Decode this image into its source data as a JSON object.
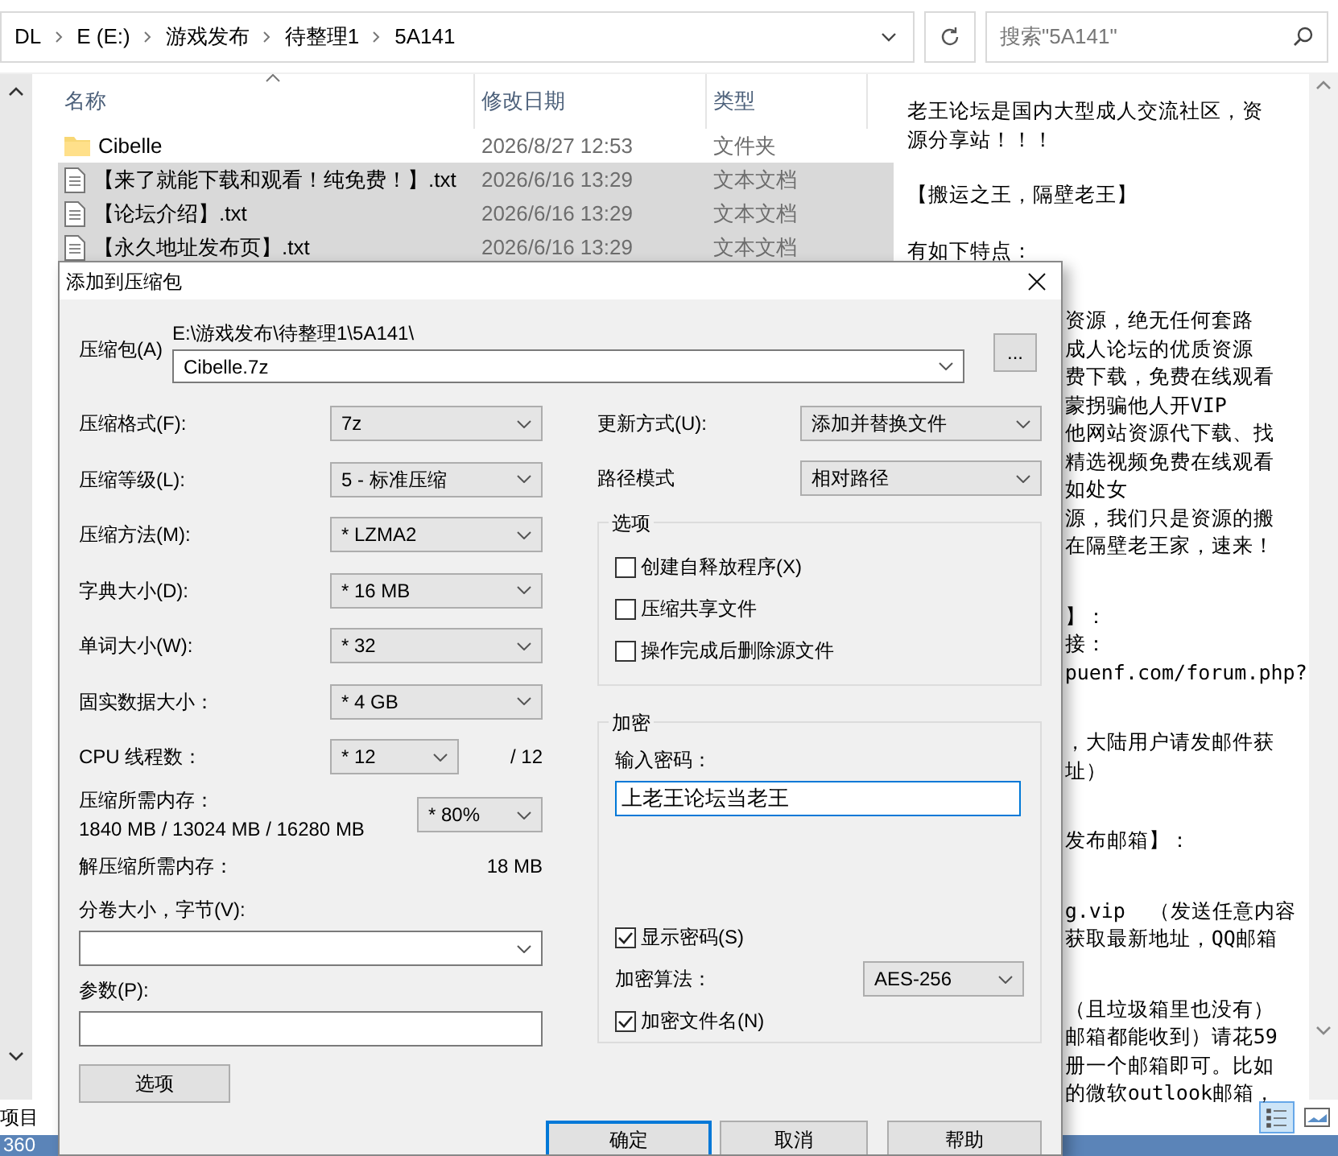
{
  "address_bar": {
    "crumbs": [
      "DL",
      "E (E:)",
      "游戏发布",
      "待整理1",
      "5A141"
    ],
    "search": {
      "placeholder": "搜索\"5A141\""
    }
  },
  "file_list": {
    "columns": [
      {
        "label": "名称",
        "sorted": true
      },
      {
        "label": "修改日期",
        "sorted": false
      },
      {
        "label": "类型",
        "sorted": false
      }
    ],
    "rows": [
      {
        "kind": "folder",
        "name": "Cibelle",
        "date": "2026/8/27 12:53",
        "type": "文件夹",
        "selected": false
      },
      {
        "kind": "text",
        "name": "【来了就能下载和观看！纯免费！】.txt",
        "date": "2026/6/16 13:29",
        "type": "文本文档",
        "selected": true
      },
      {
        "kind": "text",
        "name": "【论坛介绍】.txt",
        "date": "2026/6/16 13:29",
        "type": "文本文档",
        "selected": true
      },
      {
        "kind": "text",
        "name": "【永久地址发布页】.txt",
        "date": "2026/6/16 13:29",
        "type": "文本文档",
        "selected": true
      }
    ]
  },
  "preview": {
    "paragraphs": [
      {
        "kind": "full",
        "lines": [
          "老王论坛是国内大型成人交流社区，资",
          "源分享站！！！"
        ]
      },
      {
        "kind": "full",
        "lines": [
          "【搬运之王，隔壁老王】"
        ]
      },
      {
        "kind": "full",
        "lines": [
          "有如下特点："
        ]
      },
      {
        "kind": "partial",
        "lines": [
          "资源，绝无任何套路",
          "成人论坛的优质资源",
          "费下载，免费在线观看",
          "蒙拐骗他人开VIP",
          "他网站资源代下载、找",
          "精选视频免费在线观看",
          "如处女",
          "源，我们只是资源的搬",
          "在隔壁老王家，速来！"
        ]
      },
      {
        "kind": "partial",
        "lines": [
          "】：",
          "接：",
          "puenf.com/forum.php?"
        ]
      },
      {
        "kind": "partial",
        "lines": [
          "，大陆用户请发邮件获",
          "址）"
        ]
      },
      {
        "kind": "partial",
        "lines": [
          "发布邮箱】："
        ]
      },
      {
        "kind": "partial",
        "lines": [
          "g.vip  （发送任意内容",
          "获取最新地址，QQ邮箱"
        ]
      },
      {
        "kind": "partial",
        "lines": [
          "（且垃圾箱里也没有）",
          "邮箱都能收到）请花59",
          "册一个邮箱即可。比如",
          "的微软outlook邮箱，"
        ]
      }
    ]
  },
  "view_buttons": [
    {
      "kind": "details",
      "selected": true
    },
    {
      "kind": "thumbnails",
      "selected": false
    }
  ],
  "status_bar": {
    "text": "项目"
  },
  "taskbar": {
    "text": "360"
  },
  "dialog": {
    "title": "添加到压缩包",
    "archive": {
      "label": "压缩包(A)",
      "path": "E:\\游戏发布\\待整理1\\5A141\\",
      "value": "Cibelle.7z",
      "browse": "..."
    },
    "settings": [
      {
        "label": "压缩格式(F):",
        "value": "7z"
      },
      {
        "label": "压缩等级(L):",
        "value": "5 - 标准压缩"
      },
      {
        "label": "压缩方法(M):",
        "value": "* LZMA2"
      },
      {
        "label": "字典大小(D):",
        "value": "* 16 MB"
      },
      {
        "label": "单词大小(W):",
        "value": "* 32"
      },
      {
        "label": "固实数据大小：",
        "value": "* 4 GB"
      }
    ],
    "threads": {
      "label": "CPU 线程数：",
      "value": "* 12",
      "max": "/ 12"
    },
    "memory": {
      "label": "压缩所需内存：",
      "detail": "1840 MB / 13024 MB / 16280 MB",
      "value": "* 80%"
    },
    "decompress_memory": {
      "label": "解压缩所需内存：",
      "value": "18 MB"
    },
    "split": {
      "label": "分卷大小，字节(V):"
    },
    "params": {
      "label": "参数(P):"
    },
    "options_button": "选项",
    "update_mode": {
      "label": "更新方式(U):",
      "value": "添加并替换文件"
    },
    "path_mode": {
      "label": "路径模式",
      "value": "相对路径"
    },
    "options_group": {
      "legend": "选项",
      "items": [
        {
          "label": "创建自释放程序(X)",
          "checked": false
        },
        {
          "label": "压缩共享文件",
          "checked": false
        },
        {
          "label": "操作完成后删除源文件",
          "checked": false
        }
      ]
    },
    "encryption": {
      "legend": "加密",
      "password_label": "输入密码：",
      "password": "上老王论坛当老王",
      "show_password": {
        "label": "显示密码(S)",
        "checked": true
      },
      "method": {
        "label": "加密算法：",
        "value": "AES-256"
      },
      "encrypt_names": {
        "label": "加密文件名(N)",
        "checked": true
      }
    },
    "buttons": [
      {
        "label": "确定",
        "focused": true
      },
      {
        "label": "取消",
        "focused": false
      },
      {
        "label": "帮助",
        "focused": false
      }
    ]
  }
}
